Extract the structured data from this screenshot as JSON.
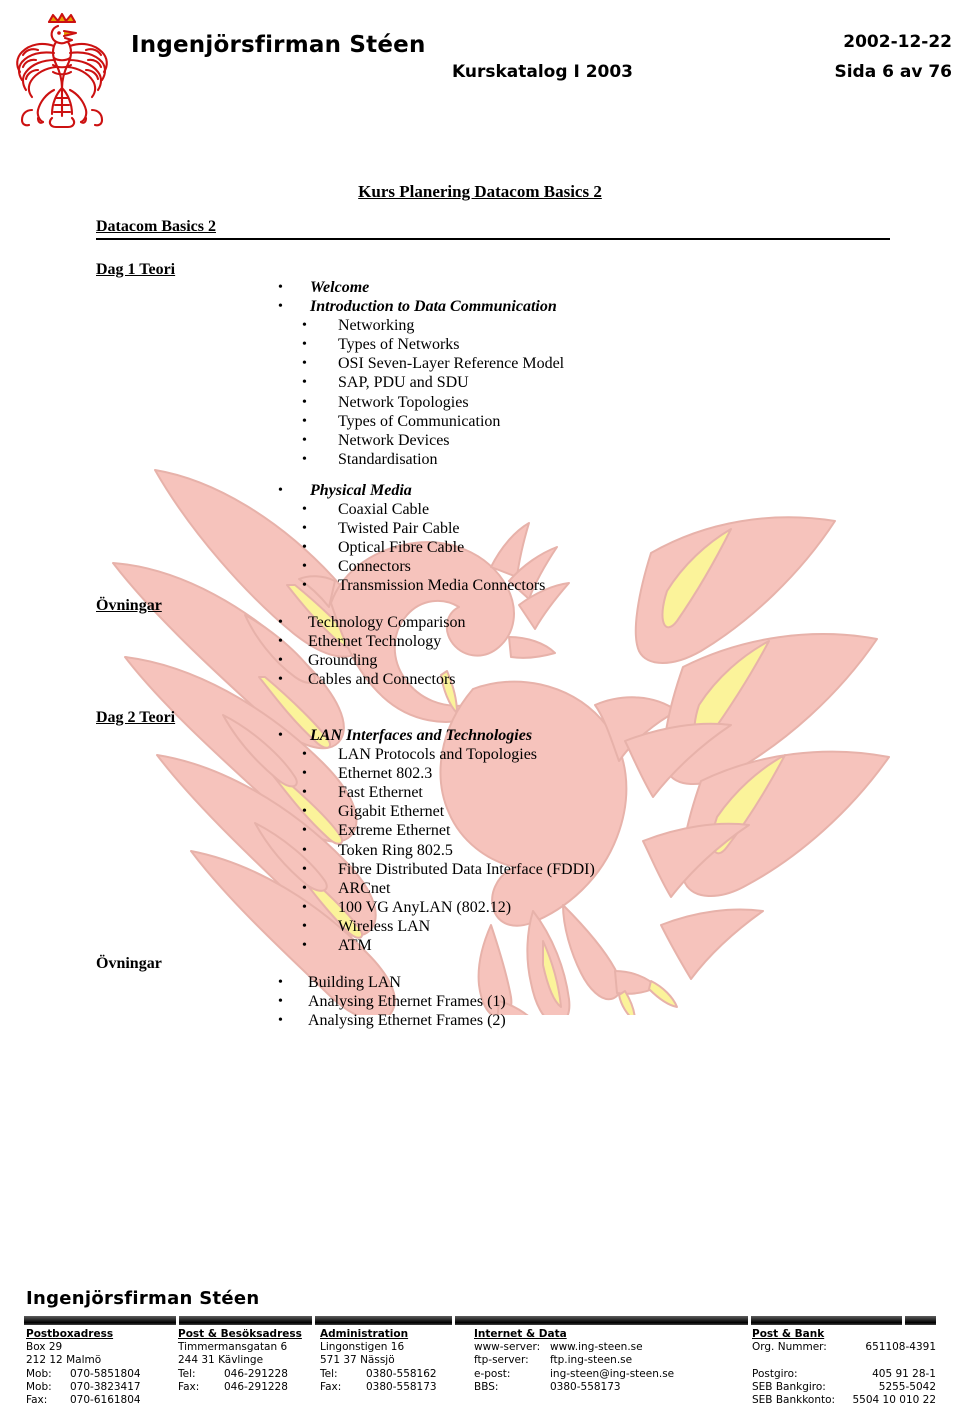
{
  "header": {
    "logo_icon": "polish-eagle-crest-icon",
    "company": "Ingenjörsfirman Stéen",
    "catalog": "Kurskatalog I 2003",
    "date": "2002-12-22",
    "page": "Sida 6 av 76"
  },
  "watermark": {
    "icon": "eagle-watermark-icon",
    "body_color": "#f6c3bc",
    "accent_color": "#fbf39a",
    "outline_color": "#e8b0a8"
  },
  "document": {
    "title": "Kurs Planering Datacom Basics 2",
    "course_heading": "Datacom Basics 2",
    "sections": [
      {
        "label": "Dag 1 Teori",
        "label_underlined": true,
        "groups": [
          {
            "lead": "Welcome",
            "items": []
          },
          {
            "lead": "Introduction to Data Communication",
            "items": [
              "Networking",
              "Types of Networks",
              "OSI Seven-Layer Reference Model",
              "SAP, PDU and SDU",
              "Network Topologies",
              "Types of Communication",
              "Network Devices",
              "Standardisation"
            ]
          },
          {
            "lead": "Physical Media",
            "items": [
              "Coaxial Cable",
              "Twisted Pair Cable",
              "Optical Fibre Cable",
              "Connectors",
              "Transmission Media Connectors"
            ]
          }
        ]
      },
      {
        "label": "Övningar",
        "label_underlined": true,
        "plain_items": [
          "Technology Comparison",
          "Ethernet Technology",
          "Grounding",
          "Cables and Connectors"
        ]
      },
      {
        "label": "Dag 2 Teori",
        "label_underlined": true,
        "groups": [
          {
            "lead": "LAN Interfaces and Technologies",
            "items": [
              "LAN Protocols and Topologies",
              "Ethernet 802.3",
              "Fast Ethernet",
              "Gigabit Ethernet",
              "Extreme Ethernet",
              "Token Ring 802.5",
              "Fibre Distributed Data Interface (FDDI)",
              "ARCnet",
              "100 VG AnyLAN (802.12)",
              "Wireless LAN",
              "ATM"
            ]
          }
        ]
      },
      {
        "label": "Övningar",
        "label_underlined": false,
        "plain_items": [
          "Building LAN",
          "Analysing Ethernet Frames (1)",
          "Analysing Ethernet Frames (2)"
        ]
      }
    ]
  },
  "footer": {
    "company": "Ingenjörsfirman Stéen",
    "columns": [
      {
        "heading": "Postboxadress",
        "rows": [
          {
            "key": "Box 29",
            "value": ""
          },
          {
            "key": "212 12 Malmö",
            "value": ""
          },
          {
            "key": "Mob:",
            "value": "070-5851804"
          },
          {
            "key": "Mob:",
            "value": "070-3823417"
          },
          {
            "key": "Fax:",
            "value": "070-6161804"
          }
        ]
      },
      {
        "heading": "Post & Besöksadress",
        "rows": [
          {
            "key": "Timmermansgatan 6",
            "value": ""
          },
          {
            "key": "244 31 Kävlinge",
            "value": ""
          },
          {
            "key": "Tel:",
            "value": "046-291228"
          },
          {
            "key": "Fax:",
            "value": "046-291228"
          }
        ]
      },
      {
        "heading": "Administration",
        "rows": [
          {
            "key": "Lingonstigen 16",
            "value": ""
          },
          {
            "key": "571 37 Nässjö",
            "value": ""
          },
          {
            "key": "Tel:",
            "value": "0380-558162"
          },
          {
            "key": "Fax:",
            "value": "0380-558173"
          }
        ]
      },
      {
        "heading": "Internet & Data",
        "rows": [
          {
            "key": "www-server:",
            "value": "www.ing-steen.se"
          },
          {
            "key": "ftp-server:",
            "value": "ftp.ing-steen.se"
          },
          {
            "key": "e-post:",
            "value": "ing-steen@ing-steen.se"
          },
          {
            "key": "BBS:",
            "value": "0380-558173"
          }
        ]
      },
      {
        "heading": "Post & Bank",
        "rows": [
          {
            "key": "Org. Nummer:",
            "value": "651108-4391"
          },
          {
            "key": "",
            "value": ""
          },
          {
            "key": "Postgiro:",
            "value": "405 91 28-1"
          },
          {
            "key": "SEB Bankgiro:",
            "value": "5255-5042"
          },
          {
            "key": "SEB Bankkonto:",
            "value": "5504 10 010 22"
          }
        ]
      }
    ]
  }
}
